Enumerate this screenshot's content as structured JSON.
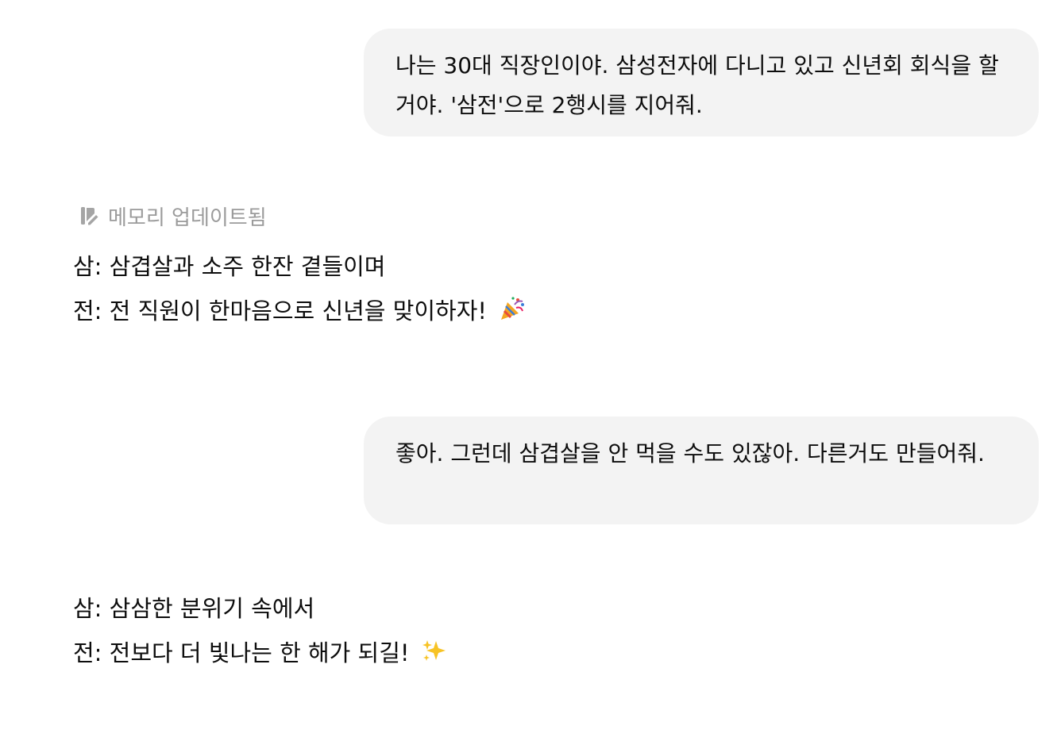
{
  "conversation": {
    "user_message_1": "나는 30대 직장인이야. 삼성전자에 다니고 있고 신년회 회식을 할거야. '삼전'으로 2행시를 지어줘.",
    "memory_note": "메모리 업데이트됨",
    "memory_icon": "memory-edit-icon",
    "assistant_1": {
      "line_1": "삼: 삼겹살과 소주 한잔 곁들이며",
      "line_2": "전: 전 직원이 한마음으로 신년을 맞이하자!",
      "line_2_emoji": "party-popper-icon"
    },
    "user_message_2": "좋아. 그런데 삼겹살을 안 먹을 수도 있잖아. 다른거도 만들어줘.",
    "assistant_2": {
      "line_1": "삼: 삼삼한 분위기 속에서",
      "line_2": "전: 전보다 더 빛나는 한 해가 되길!",
      "line_2_emoji": "sparkles-icon"
    }
  }
}
